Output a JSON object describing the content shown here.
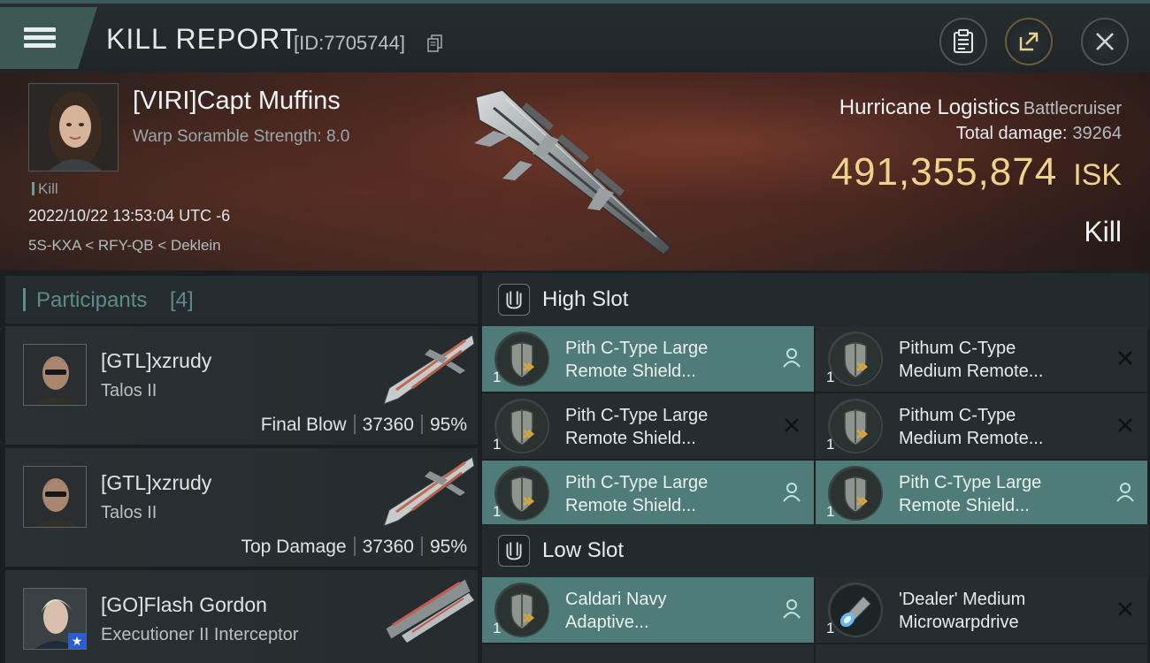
{
  "header": {
    "title": "KILL REPORT",
    "id_text": "[ID:7705744]"
  },
  "victim": {
    "name": "[VIRI]Capt Muffins",
    "warp": "Warp Soramble Strength: 8.0",
    "tag": "Kill",
    "datetime": "2022/10/22 13:53:04 UTC -6",
    "location": "5S-KXA < RFY-QB < Deklein"
  },
  "ship": {
    "name": "Hurricane Logistics",
    "class": "Battlecruiser",
    "total_damage_label": "Total damage:",
    "total_damage": "39264",
    "isk_value": "491,355,874",
    "isk_unit": "ISK",
    "kill_type": "Kill"
  },
  "participants": {
    "title": "Participants",
    "count": "[4]",
    "items": [
      {
        "name": "[GTL]xzrudy",
        "ship": "Talos II",
        "role": "Final Blow",
        "damage": "37360",
        "percent": "95%"
      },
      {
        "name": "[GTL]xzrudy",
        "ship": "Talos II",
        "role": "Top Damage",
        "damage": "37360",
        "percent": "95%"
      },
      {
        "name": "[GO]Flash Gordon",
        "ship": "Executioner II Interceptor"
      }
    ]
  },
  "slots": {
    "high": {
      "title": "High Slot",
      "modules": [
        {
          "qty": "1",
          "line1": "Pith C-Type Large",
          "line2": "Remote Shield...",
          "status": "person"
        },
        {
          "qty": "1",
          "line1": "Pithum C-Type",
          "line2": "Medium Remote...",
          "status": "x"
        },
        {
          "qty": "1",
          "line1": "Pith C-Type Large",
          "line2": "Remote Shield...",
          "status": "x"
        },
        {
          "qty": "1",
          "line1": "Pithum C-Type",
          "line2": "Medium Remote...",
          "status": "x"
        },
        {
          "qty": "1",
          "line1": "Pith C-Type Large",
          "line2": "Remote Shield...",
          "status": "person"
        },
        {
          "qty": "1",
          "line1": "Pith C-Type Large",
          "line2": "Remote Shield...",
          "status": "person"
        }
      ]
    },
    "low": {
      "title": "Low Slot",
      "modules": [
        {
          "qty": "1",
          "line1": "Caldari Navy",
          "line2": "Adaptive...",
          "status": "person"
        },
        {
          "qty": "1",
          "line1": "'Dealer' Medium",
          "line2": "Microwarpdrive",
          "status": "x"
        }
      ]
    }
  },
  "icons": {
    "menu": "hamburger-menu-icon",
    "copy": "copy-icon",
    "clipboard": "clipboard-icon",
    "share": "share-icon",
    "close": "close-icon",
    "slot": "slot-icon",
    "person": "person-icon",
    "x": "x-icon"
  },
  "colors": {
    "accent": "#4f7c78",
    "isk": "#f0d28c",
    "participants_title": "#5f8a89"
  }
}
